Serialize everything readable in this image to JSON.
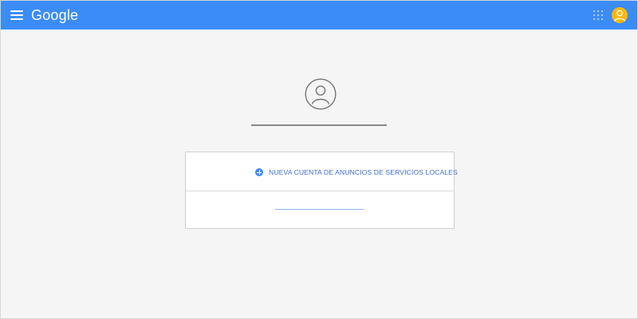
{
  "header": {
    "brand": "Google",
    "menu_icon": "hamburger-menu-icon",
    "apps_icon": "apps-grid-icon",
    "avatar_icon": "account-avatar-icon",
    "bar_color": "#3b8cf7",
    "avatar_color": "#f9b90a"
  },
  "profile": {
    "icon": "person-circle-icon",
    "name": ""
  },
  "accounts": {
    "new_account_label": "NUEVA CUENTA DE ANUNCIOS DE SERVICIOS LOCALES",
    "new_account_icon": "plus-circle-icon",
    "link_text": "",
    "accent_color": "#3f6fcf"
  }
}
